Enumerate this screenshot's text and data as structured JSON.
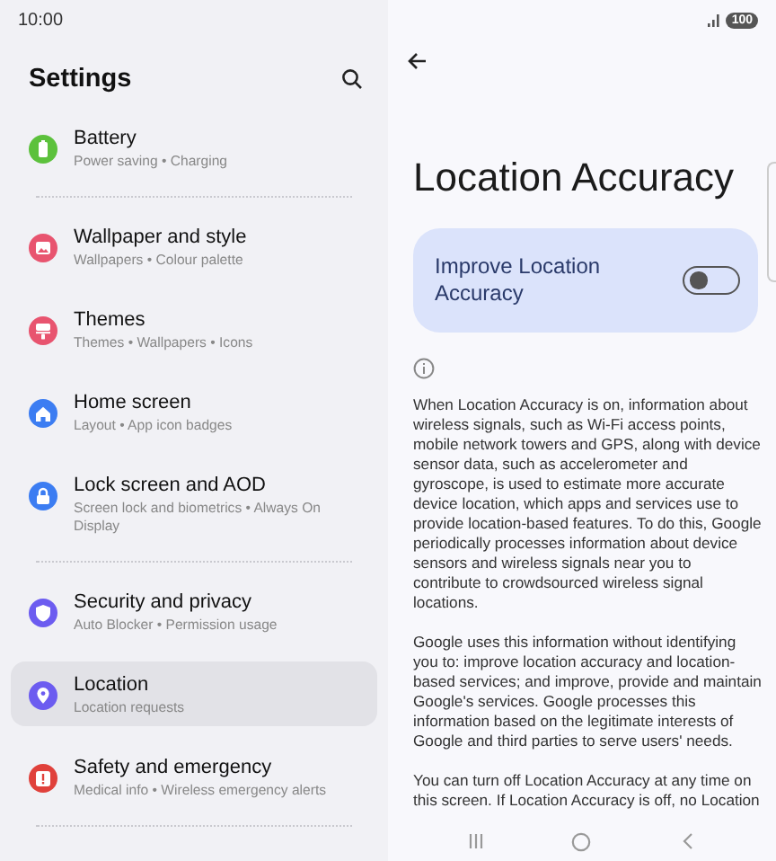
{
  "status_bar": {
    "time": "10:00",
    "battery": "100"
  },
  "settings": {
    "title": "Settings",
    "groups": [
      [
        {
          "kind": "battery",
          "title": "Battery",
          "subtitle": "Power saving • Charging",
          "color": "#5cc13c",
          "selected": false
        }
      ],
      [
        {
          "kind": "wallpaper",
          "title": "Wallpaper and style",
          "subtitle": "Wallpapers • Colour palette",
          "color": "#e8546f",
          "selected": false
        },
        {
          "kind": "themes",
          "title": "Themes",
          "subtitle": "Themes • Wallpapers • Icons",
          "color": "#e8546f",
          "selected": false
        },
        {
          "kind": "home",
          "title": "Home screen",
          "subtitle": "Layout • App icon badges",
          "color": "#3c7df2",
          "selected": false
        },
        {
          "kind": "lock",
          "title": "Lock screen and AOD",
          "subtitle": "Screen lock and biometrics • Always On Display",
          "color": "#3c7df2",
          "selected": false
        }
      ],
      [
        {
          "kind": "shield",
          "title": "Security and privacy",
          "subtitle": "Auto Blocker • Permission usage",
          "color": "#6c5cf0",
          "selected": false
        },
        {
          "kind": "pin",
          "title": "Location",
          "subtitle": "Location requests",
          "color": "#6c5cf0",
          "selected": true
        },
        {
          "kind": "alert",
          "title": "Safety and emergency",
          "subtitle": "Medical info • Wireless emergency alerts",
          "color": "#e0413b",
          "selected": false
        }
      ]
    ]
  },
  "detail": {
    "title": "Location Accuracy",
    "toggle": {
      "label": "Improve Location Accuracy",
      "on": false
    },
    "paragraphs": [
      "When Location Accuracy is on, information about wireless signals, such as Wi-Fi access points, mobile network towers and GPS, along with device sensor data, such as accelerometer and gyroscope, is used to estimate more accurate device location, which apps and services use to provide location-based features. To do this, Google periodically processes information about device sensors and wireless signals near you to contribute to crowdsourced wireless signal locations.",
      "Google uses this information without identifying you to: improve location accuracy and location-based services; and improve, provide and maintain Google's services. Google processes this information based on the legitimate interests of Google and third parties to serve users' needs.",
      "You can turn off Location Accuracy at any time on this screen. If Location Accuracy is off, no Location"
    ]
  }
}
